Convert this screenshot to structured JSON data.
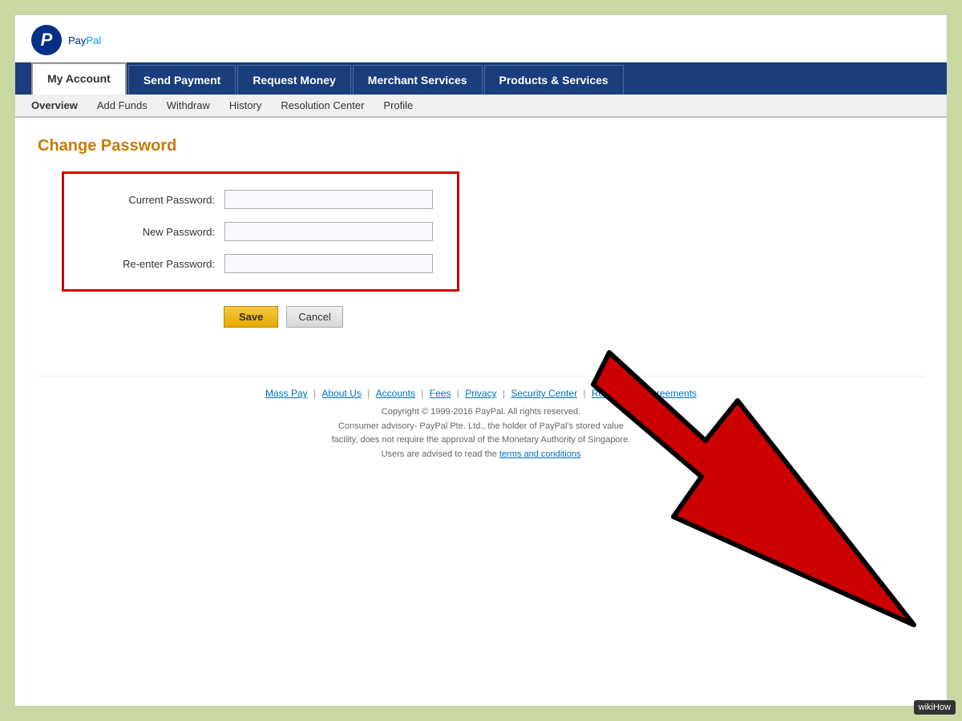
{
  "app": {
    "name": "PayPal",
    "logo_letter": "P",
    "logo_pay": "Pay",
    "logo_pal": "Pal"
  },
  "main_nav": {
    "tabs": [
      {
        "id": "my-account",
        "label": "My Account",
        "active": true
      },
      {
        "id": "send-payment",
        "label": "Send Payment",
        "active": false
      },
      {
        "id": "request-money",
        "label": "Request Money",
        "active": false
      },
      {
        "id": "merchant-services",
        "label": "Merchant Services",
        "active": false
      },
      {
        "id": "products-services",
        "label": "Products & Services",
        "active": false
      }
    ]
  },
  "sub_nav": {
    "items": [
      {
        "id": "overview",
        "label": "Overview",
        "active": true
      },
      {
        "id": "add-funds",
        "label": "Add Funds",
        "active": false
      },
      {
        "id": "withdraw",
        "label": "Withdraw",
        "active": false
      },
      {
        "id": "history",
        "label": "History",
        "active": false
      },
      {
        "id": "resolution-center",
        "label": "Resolution Center",
        "active": false
      },
      {
        "id": "profile",
        "label": "Profile",
        "active": false
      }
    ]
  },
  "page": {
    "title": "Change Password",
    "form": {
      "current_password_label": "Current Password:",
      "new_password_label": "New Password:",
      "reenter_password_label": "Re-enter Password:"
    },
    "buttons": {
      "save": "Save",
      "cancel": "Cancel"
    }
  },
  "footer": {
    "links": [
      {
        "label": "Mass Pay"
      },
      {
        "label": "About Us"
      },
      {
        "label": "Accounts"
      },
      {
        "label": "Fees"
      },
      {
        "label": "Privacy"
      },
      {
        "label": "Security Center"
      },
      {
        "label": "Referrals"
      },
      {
        "label": "Agreements"
      }
    ],
    "copyright_line1": "Copyright © 1999-2016 PayPal. All rights reserved.",
    "copyright_line2": "Consumer advisory- PayPal Pte. Ltd., the holder of PayPal's stored value",
    "copyright_line3": "facility, does not require the approval of the Monetary Authority of Singapore.",
    "copyright_line4": "Users are advised to read the",
    "terms_link": "terms and conditions",
    "wikihow": "wikiHow"
  }
}
